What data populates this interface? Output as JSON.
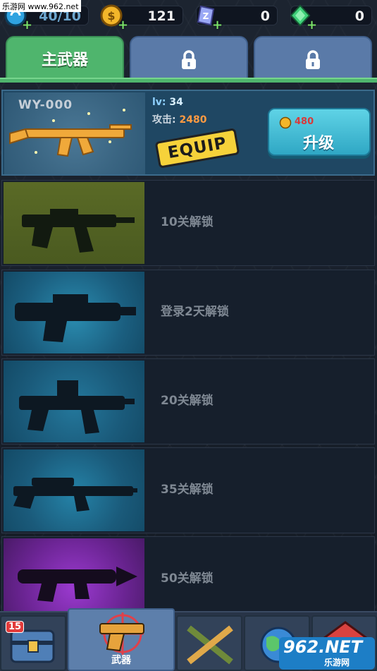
{
  "watermark": "乐游网 www.962.net",
  "resources": {
    "energy": "40/10",
    "coins": "121",
    "crystals": "0",
    "gems": "0"
  },
  "tabs": [
    {
      "label": "主武器",
      "state": "active"
    },
    {
      "label": "",
      "state": "locked"
    },
    {
      "label": "",
      "state": "locked"
    }
  ],
  "equipped": {
    "name": "WY-000",
    "level_label": "lv:",
    "level": "34",
    "attack_label": "攻击:",
    "attack": "2480",
    "equip_label": "EQUIP",
    "upgrade_cost": "480",
    "upgrade_label": "升级"
  },
  "locked_weapons": [
    {
      "unlock_text": "10关解锁",
      "tint": "#6d7a2c"
    },
    {
      "unlock_text": "登录2天解锁",
      "tint": "#1e6e8e"
    },
    {
      "unlock_text": "20关解锁",
      "tint": "#1b6286"
    },
    {
      "unlock_text": "35关解锁",
      "tint": "#1b6286"
    },
    {
      "unlock_text": "50关解锁",
      "tint": "#7a2fae"
    }
  ],
  "bottom_nav": {
    "chest_badge": "15",
    "weapons_label": "武器"
  },
  "corner_watermark": {
    "big": "962.NET",
    "small": "乐游网"
  },
  "colors": {
    "tab_active": "#4fb56d",
    "tab_locked": "#5a7aa8",
    "upgrade_button": "#3dbcd6",
    "equip_badge": "#f6d23a"
  }
}
